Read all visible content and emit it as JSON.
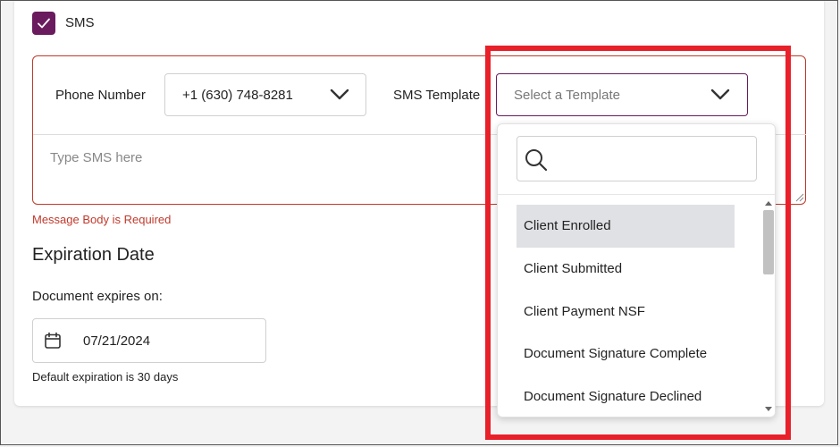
{
  "sms": {
    "label": "SMS",
    "checked": true
  },
  "phone": {
    "label": "Phone Number",
    "value": "+1 (630) 748-8281"
  },
  "template": {
    "label": "SMS Template",
    "placeholder": "Select a Template"
  },
  "sms_body": {
    "placeholder": "Type SMS here"
  },
  "error": {
    "message": "Message Body is Required"
  },
  "expiration": {
    "title": "Expiration Date",
    "label": "Document expires on:",
    "date": "07/21/2024",
    "hint": "Default expiration is 30 days"
  },
  "dropdown": {
    "search_value": "",
    "options": [
      "Client Enrolled",
      "Client Submitted",
      "Client Payment NSF",
      "Document Signature Complete",
      "Document Signature Declined"
    ],
    "selected": "Client Enrolled"
  },
  "colors": {
    "accent": "#6a1b5e",
    "error": "#c0392b",
    "highlight": "#e8202a"
  }
}
